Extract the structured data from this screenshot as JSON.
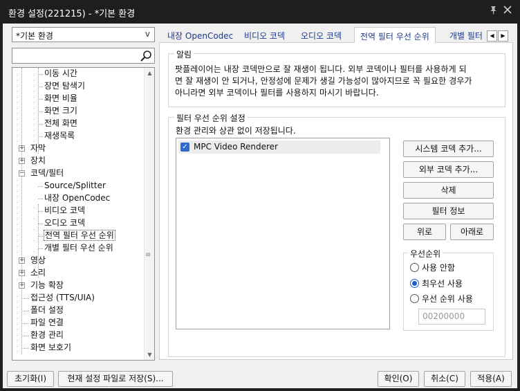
{
  "window": {
    "title": "환경 설정(221215) - *기본 환경",
    "pin_icon": "pin-icon",
    "close_icon": "close-icon"
  },
  "profile": {
    "selected": "*기본 환경",
    "arrow": "v"
  },
  "search": {
    "value": "",
    "icon": "search-icon"
  },
  "tree": [
    "이동 시간",
    "장면 탐색기",
    "화면 비율",
    "화면 크기",
    "전체 화면",
    "재생목록",
    "자막",
    "장치",
    "코덱/필터",
    "Source/Splitter",
    "내장 OpenCodec",
    "비디오 코덱",
    "오디오 코덱",
    "전역 필터 우선 순위",
    "개별 필터 우선 순위",
    "영상",
    "소리",
    "기능 확장",
    "접근성 (TTS/UIA)",
    "폴더 설정",
    "파일 연결",
    "환경 관리",
    "화면 보호기"
  ],
  "tabs": [
    "내장 OpenCodec",
    "비디오 코덱",
    "오디오 코덱",
    "전역 필터 우선 순위",
    "개별 필터"
  ],
  "notice": {
    "legend": "알림",
    "lines": [
      "팟플레이어는 내장 코덱만으로 잘 재생이 됩니다. 외부 코덱이나 필터를 사용하게 되",
      "면 잘 재생이 안 되거나, 안정성에 문제가 생길 가능성이 많아지므로 꼭 필요한 경우가",
      "아니라면 외부 코덱이나 필터를 사용하지 마시기 바랍니다."
    ]
  },
  "filter_priority": {
    "legend": "필터 우선 순위 설정",
    "description": "환경 관리와 상관 없이 저장됩니다.",
    "items": [
      {
        "label": "MPC Video Renderer",
        "checked": true
      }
    ],
    "buttons": {
      "add_system": "시스템 코덱 추가...",
      "add_external": "외부 코덱 추가...",
      "delete": "삭제",
      "filter_info": "필터 정보",
      "up": "위로",
      "down": "아래로"
    },
    "priority": {
      "legend": "우선순위",
      "options": [
        "사용 안함",
        "최우선 사용",
        "우선 순위 사용"
      ],
      "selected": "최우선 사용",
      "value_placeholder": "00200000"
    }
  },
  "footer": {
    "reset": "초기화(I)",
    "save_current": "현재 설정 파일로 저장(S)...",
    "ok": "확인(O)",
    "cancel": "취소(C)",
    "apply": "적용(A)"
  }
}
